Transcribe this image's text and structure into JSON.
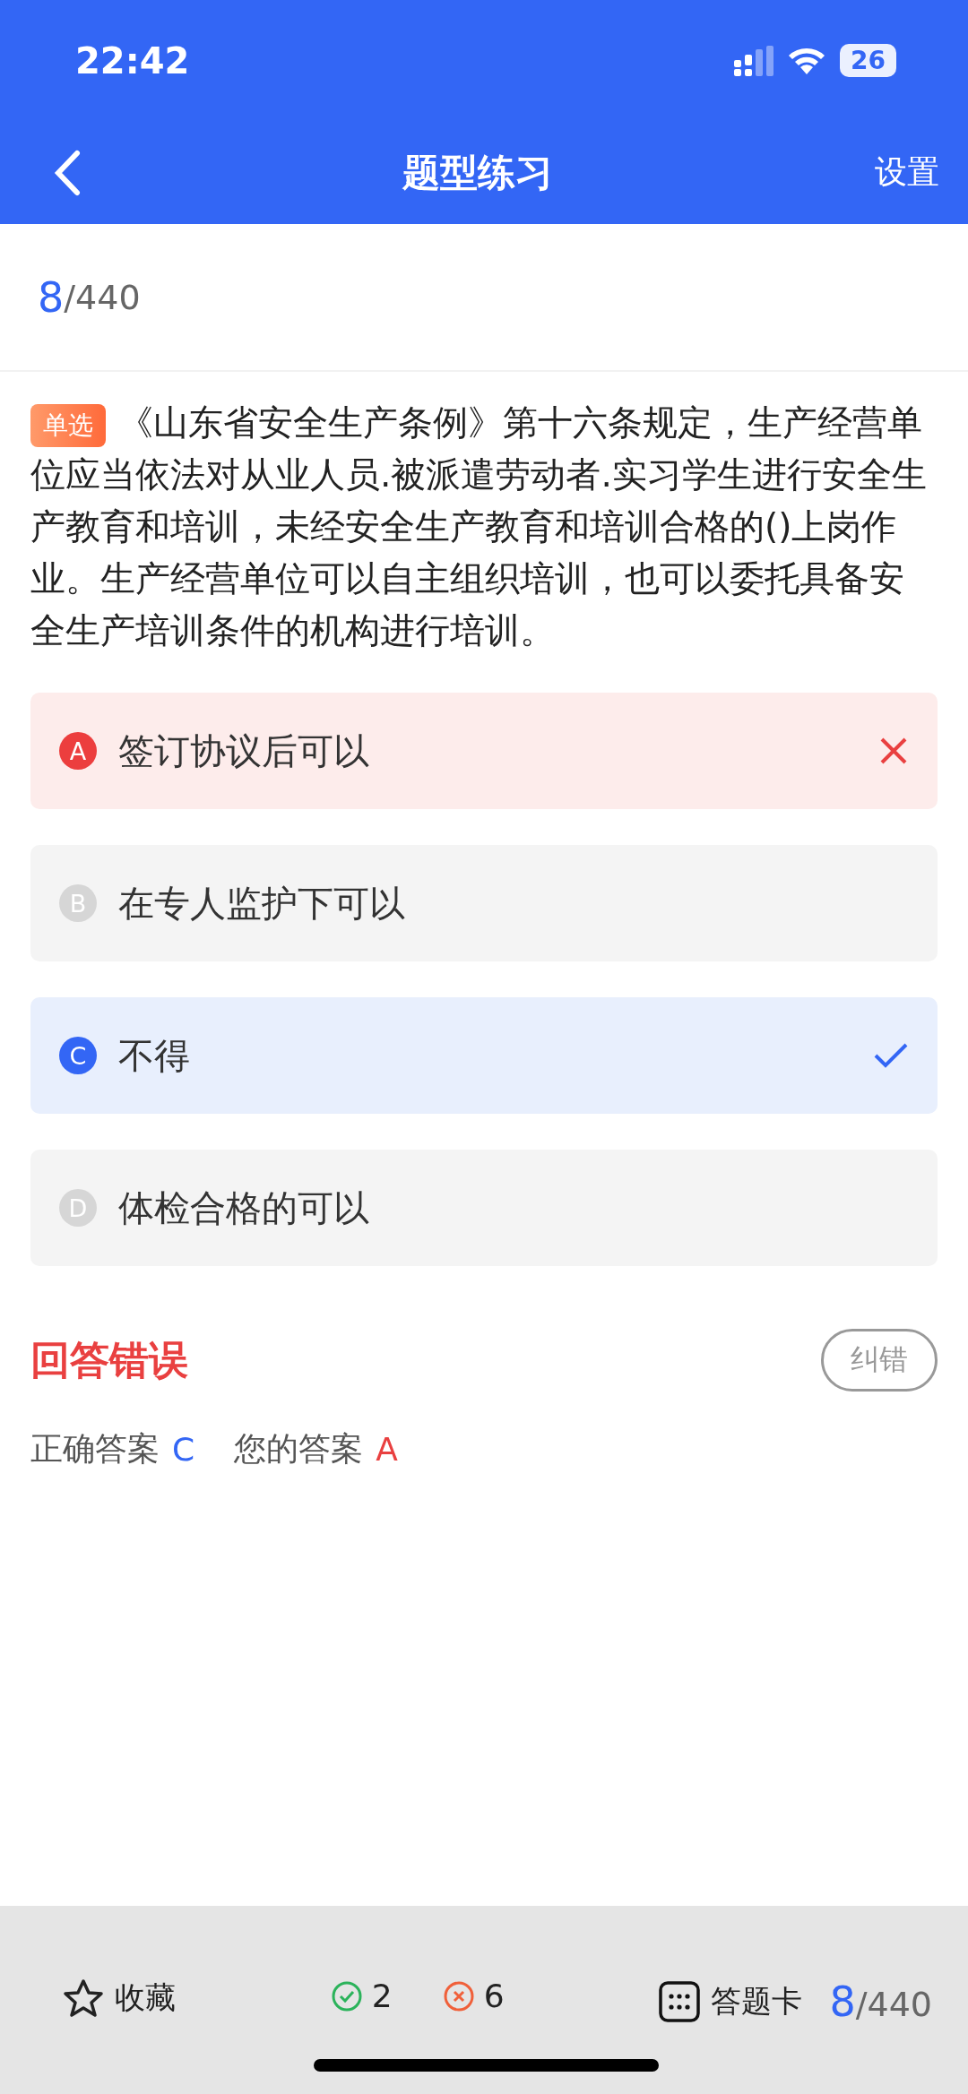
{
  "status_bar": {
    "time": "22:42",
    "battery": "26"
  },
  "nav": {
    "title": "题型练习",
    "action": "设置"
  },
  "progress": {
    "current": "8",
    "total": "/440"
  },
  "question": {
    "tag": "单选",
    "text": "《山东省安全生产条例》第十六条规定，生产经营单位应当依法对从业人员.被派遣劳动者.实习学生进行安全生产教育和培训，未经安全生产教育和培训合格的()上岗作业。生产经营单位可以自主组织培训，也可以委托具备安全生产培训条件的机构进行培训。"
  },
  "options": [
    {
      "letter": "A",
      "text": "签订协议后可以",
      "kind": "wrong"
    },
    {
      "letter": "B",
      "text": "在专人监护下可以",
      "kind": "plain"
    },
    {
      "letter": "C",
      "text": "不得",
      "kind": "correct"
    },
    {
      "letter": "D",
      "text": "体检合格的可以",
      "kind": "plain"
    }
  ],
  "result": {
    "title": "回答错误",
    "report_button": "纠错",
    "correct_label": "正确答案",
    "correct_value": "C",
    "your_label": "您的答案",
    "your_value": "A"
  },
  "bottom_bar": {
    "favorite": "收藏",
    "right_count": "2",
    "wrong_count": "6",
    "card": "答题卡",
    "current": "8",
    "total": "/440"
  }
}
